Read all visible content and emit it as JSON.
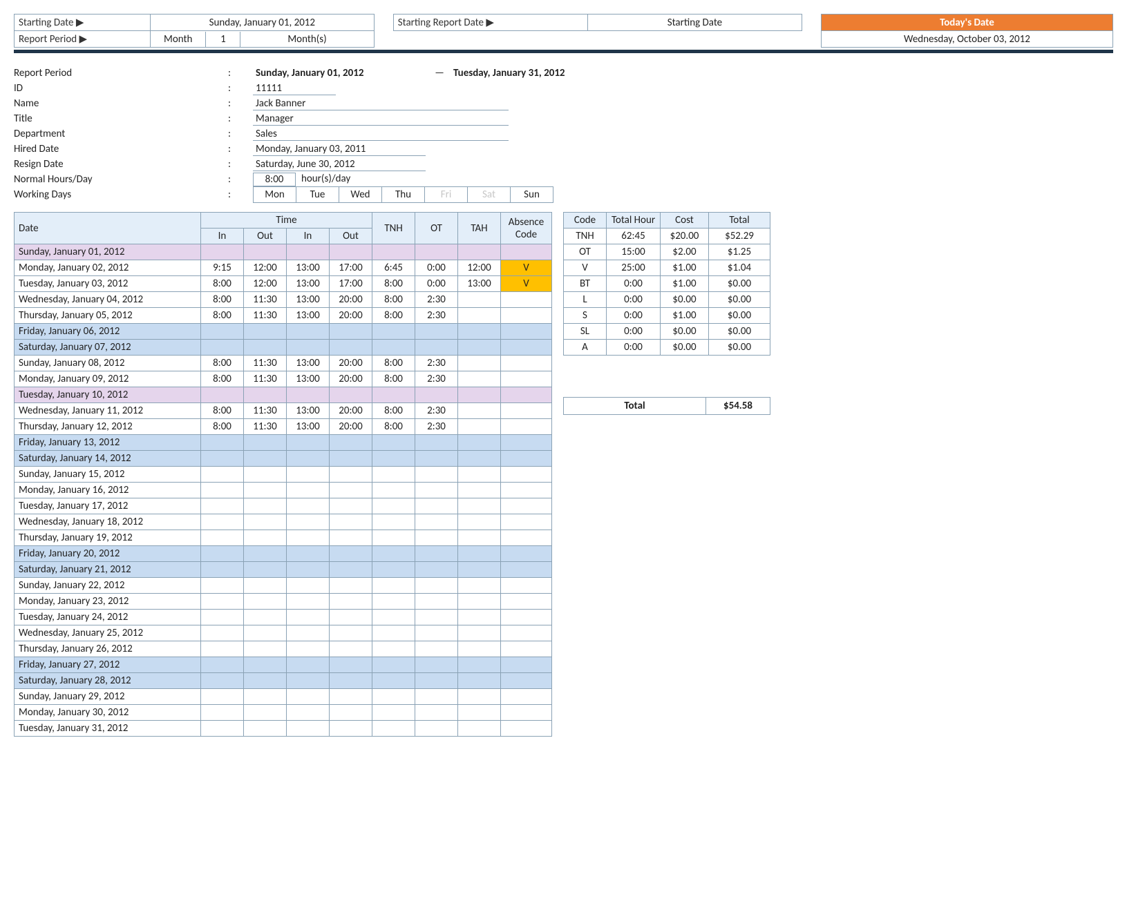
{
  "top": {
    "starting_date_label": "Starting Date ▶",
    "starting_date_value": "Sunday, January 01, 2012",
    "starting_report_date_label": "Starting Report Date ▶",
    "starting_report_date_value": "Starting Date",
    "todays_date_label": "Today's Date",
    "todays_date_value": "Wednesday, October 03, 2012",
    "report_period_label": "Report Period ▶",
    "report_period_unit": "Month",
    "report_period_count": "1",
    "report_period_suffix": "Month(s)"
  },
  "info": {
    "report_period_label": "Report Period",
    "report_period_start": "Sunday, January 01, 2012",
    "report_period_dash": "—",
    "report_period_end": "Tuesday, January 31, 2012",
    "id_label": "ID",
    "id_value": "11111",
    "name_label": "Name",
    "name_value": "Jack Banner",
    "title_label": "Title",
    "title_value": "Manager",
    "department_label": "Department",
    "department_value": "Sales",
    "hired_label": "Hired Date",
    "hired_value": "Monday, January 03, 2011",
    "resign_label": "Resign Date",
    "resign_value": "Saturday, June 30, 2012",
    "normal_hours_label": "Normal Hours/Day",
    "normal_hours_value": "8:00",
    "normal_hours_suffix": "hour(s)/day",
    "working_days_label": "Working Days",
    "working_days": [
      "Mon",
      "Tue",
      "Wed",
      "Thu",
      "Fri",
      "Sat",
      "Sun"
    ],
    "working_days_faded": [
      false,
      false,
      false,
      false,
      true,
      true,
      false
    ]
  },
  "ts": {
    "headers": {
      "date": "Date",
      "time": "Time",
      "in": "In",
      "out": "Out",
      "tnh": "TNH",
      "ot": "OT",
      "tah": "TAH",
      "abs": "Absence Code"
    },
    "rows": [
      {
        "date": "Sunday, January 01, 2012",
        "tone": "purple"
      },
      {
        "date": "Monday, January 02, 2012",
        "tone": "plain",
        "in1": "9:15",
        "out1": "12:00",
        "in2": "13:00",
        "out2": "17:00",
        "tnh": "6:45",
        "ot": "0:00",
        "tah": "12:00",
        "abs": "V"
      },
      {
        "date": "Tuesday, January 03, 2012",
        "tone": "plain",
        "in1": "8:00",
        "out1": "12:00",
        "in2": "13:00",
        "out2": "17:00",
        "tnh": "8:00",
        "ot": "0:00",
        "tah": "13:00",
        "abs": "V"
      },
      {
        "date": "Wednesday, January 04, 2012",
        "tone": "plain",
        "in1": "8:00",
        "out1": "11:30",
        "in2": "13:00",
        "out2": "20:00",
        "tnh": "8:00",
        "ot": "2:30"
      },
      {
        "date": "Thursday, January 05, 2012",
        "tone": "plain",
        "in1": "8:00",
        "out1": "11:30",
        "in2": "13:00",
        "out2": "20:00",
        "tnh": "8:00",
        "ot": "2:30"
      },
      {
        "date": "Friday, January 06, 2012",
        "tone": "blue"
      },
      {
        "date": "Saturday, January 07, 2012",
        "tone": "blue"
      },
      {
        "date": "Sunday, January 08, 2012",
        "tone": "plain",
        "in1": "8:00",
        "out1": "11:30",
        "in2": "13:00",
        "out2": "20:00",
        "tnh": "8:00",
        "ot": "2:30"
      },
      {
        "date": "Monday, January 09, 2012",
        "tone": "plain",
        "in1": "8:00",
        "out1": "11:30",
        "in2": "13:00",
        "out2": "20:00",
        "tnh": "8:00",
        "ot": "2:30"
      },
      {
        "date": "Tuesday, January 10, 2012",
        "tone": "purple"
      },
      {
        "date": "Wednesday, January 11, 2012",
        "tone": "plain",
        "in1": "8:00",
        "out1": "11:30",
        "in2": "13:00",
        "out2": "20:00",
        "tnh": "8:00",
        "ot": "2:30"
      },
      {
        "date": "Thursday, January 12, 2012",
        "tone": "plain",
        "in1": "8:00",
        "out1": "11:30",
        "in2": "13:00",
        "out2": "20:00",
        "tnh": "8:00",
        "ot": "2:30"
      },
      {
        "date": "Friday, January 13, 2012",
        "tone": "blue"
      },
      {
        "date": "Saturday, January 14, 2012",
        "tone": "blue"
      },
      {
        "date": "Sunday, January 15, 2012",
        "tone": "plain"
      },
      {
        "date": "Monday, January 16, 2012",
        "tone": "plain"
      },
      {
        "date": "Tuesday, January 17, 2012",
        "tone": "plain"
      },
      {
        "date": "Wednesday, January 18, 2012",
        "tone": "plain"
      },
      {
        "date": "Thursday, January 19, 2012",
        "tone": "plain"
      },
      {
        "date": "Friday, January 20, 2012",
        "tone": "blue"
      },
      {
        "date": "Saturday, January 21, 2012",
        "tone": "blue"
      },
      {
        "date": "Sunday, January 22, 2012",
        "tone": "plain"
      },
      {
        "date": "Monday, January 23, 2012",
        "tone": "plain"
      },
      {
        "date": "Tuesday, January 24, 2012",
        "tone": "plain"
      },
      {
        "date": "Wednesday, January 25, 2012",
        "tone": "plain"
      },
      {
        "date": "Thursday, January 26, 2012",
        "tone": "plain"
      },
      {
        "date": "Friday, January 27, 2012",
        "tone": "blue"
      },
      {
        "date": "Saturday, January 28, 2012",
        "tone": "blue"
      },
      {
        "date": "Sunday, January 29, 2012",
        "tone": "plain"
      },
      {
        "date": "Monday, January 30, 2012",
        "tone": "plain"
      },
      {
        "date": "Tuesday, January 31, 2012",
        "tone": "plain"
      }
    ]
  },
  "summary": {
    "headers": {
      "code": "Code",
      "hour": "Total Hour",
      "cost": "Cost",
      "total": "Total"
    },
    "rows": [
      {
        "code": "TNH",
        "hour": "62:45",
        "cost": "$20.00",
        "total": "$52.29"
      },
      {
        "code": "OT",
        "hour": "15:00",
        "cost": "$2.00",
        "total": "$1.25"
      },
      {
        "code": "V",
        "hour": "25:00",
        "cost": "$1.00",
        "total": "$1.04"
      },
      {
        "code": "BT",
        "hour": "0:00",
        "cost": "$1.00",
        "total": "$0.00"
      },
      {
        "code": "L",
        "hour": "0:00",
        "cost": "$0.00",
        "total": "$0.00"
      },
      {
        "code": "S",
        "hour": "0:00",
        "cost": "$1.00",
        "total": "$0.00"
      },
      {
        "code": "SL",
        "hour": "0:00",
        "cost": "$0.00",
        "total": "$0.00"
      },
      {
        "code": "A",
        "hour": "0:00",
        "cost": "$0.00",
        "total": "$0.00"
      }
    ],
    "grand_total_label": "Total",
    "grand_total_value": "$54.58"
  }
}
